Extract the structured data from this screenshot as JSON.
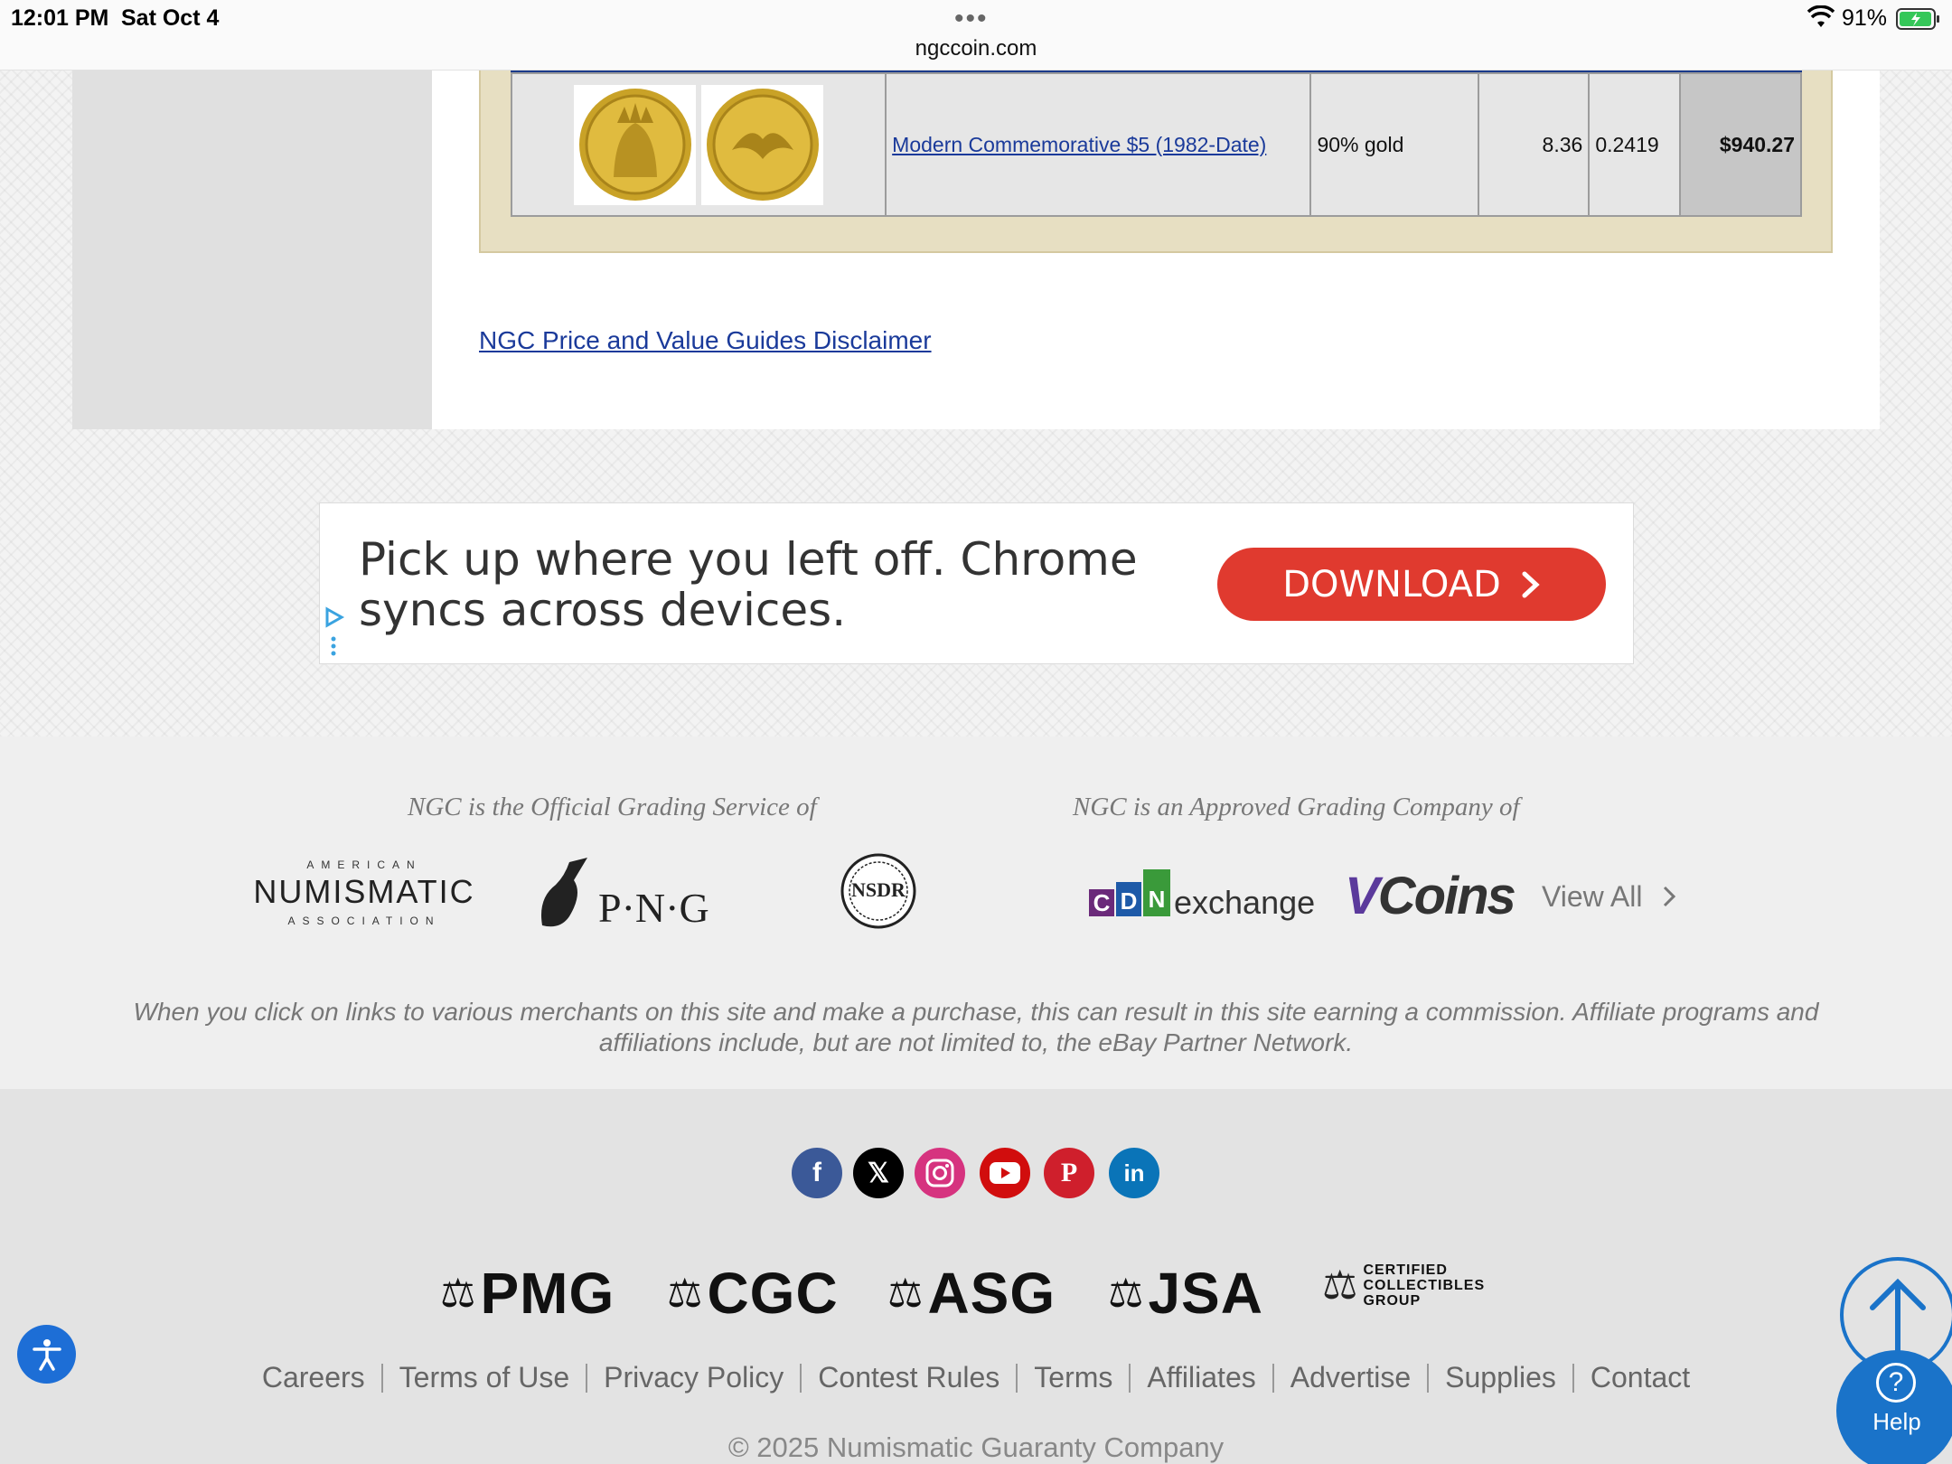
{
  "status_bar": {
    "time": "12:01 PM",
    "date": "Sat Oct 4",
    "url": "ngccoin.com",
    "battery": "91%"
  },
  "coin_row": {
    "name": "Modern Commemorative $5 (1982-Date)",
    "composition": "90% gold",
    "weight": "8.36",
    "asw": "0.2419",
    "value": "$940.27"
  },
  "disclaimer_link": "NGC Price and Value Guides Disclaimer",
  "ad": {
    "text": "Pick up where you left off. Chrome syncs across devices.",
    "button": "DOWNLOAD"
  },
  "partners": {
    "official_title": "NGC is the Official Grading Service of",
    "approved_title": "NGC is an Approved Grading Company of",
    "ana_top": "AMERICAN",
    "ana_mid": "NUMISMATIC",
    "ana_bot": "ASSOCIATION",
    "png": "P·N·G",
    "nsdr": "NSDR",
    "cdn": "exchange",
    "vcoins": "Coins",
    "view_all": "View All"
  },
  "affiliate_note": "When you click on links to various merchants on this site and make a purchase, this can result in this site earning a commission. Affiliate programs and affiliations include, but are not limited to, the eBay Partner Network.",
  "brands": [
    "PMG",
    "CGC",
    "ASG",
    "JSA"
  ],
  "ccg": [
    "CERTIFIED",
    "COLLECTIBLES",
    "GROUP"
  ],
  "footer_links": [
    "Careers",
    "Terms of Use",
    "Privacy Policy",
    "Contest Rules",
    "Terms",
    "Affiliates",
    "Advertise",
    "Supplies",
    "Contact"
  ],
  "copyright": "© 2025 Numismatic Guaranty Company",
  "help_label": "Help",
  "colors": {
    "link": "#1a3a9a",
    "ad_button": "#e03a2f",
    "help_blue": "#1a73c9"
  }
}
